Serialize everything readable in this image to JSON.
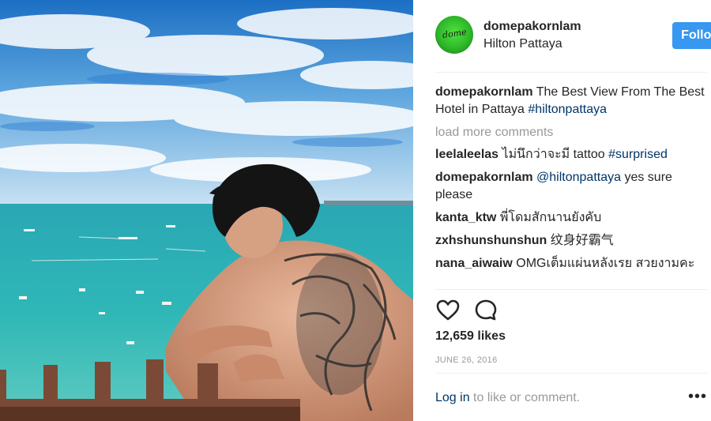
{
  "post": {
    "username": "domepakornlam",
    "location": "Hilton Pattaya",
    "follow_label": "Follow",
    "avatar_text": "dome",
    "caption_user": "domepakornlam",
    "caption_text": " The Best View From The Best Hotel in Pattaya ",
    "caption_tag": "#hiltonpattaya",
    "load_more": "load more comments",
    "comments": [
      {
        "user": "leelaleelas",
        "text": " ไม่นึกว่าจะมี tattoo ",
        "tag": "#surprised"
      },
      {
        "user": "domepakornlam",
        "tag": " @hiltonpattaya",
        "text": " yes sure please"
      },
      {
        "user": "kanta_ktw",
        "text": " พี่โดมสักนานยังคับ"
      },
      {
        "user": "zxhshunshunshun",
        "text": " 纹身好霸气"
      },
      {
        "user": "nana_aiwaiw",
        "text": " OMGเต็มแผ่นหลังเรย สวยงามคะ"
      }
    ],
    "likes": "12,659 likes",
    "date": "JUNE 26, 2016",
    "login_link": "Log in",
    "login_rest": " to like or comment.",
    "more_label": "•••"
  },
  "icons": {
    "like": "heart-outline-icon",
    "comment": "speech-bubble-icon",
    "more": "ellipsis-icon"
  },
  "colors": {
    "follow_button": "#3897f0",
    "link": "#003569",
    "muted": "#999999"
  }
}
